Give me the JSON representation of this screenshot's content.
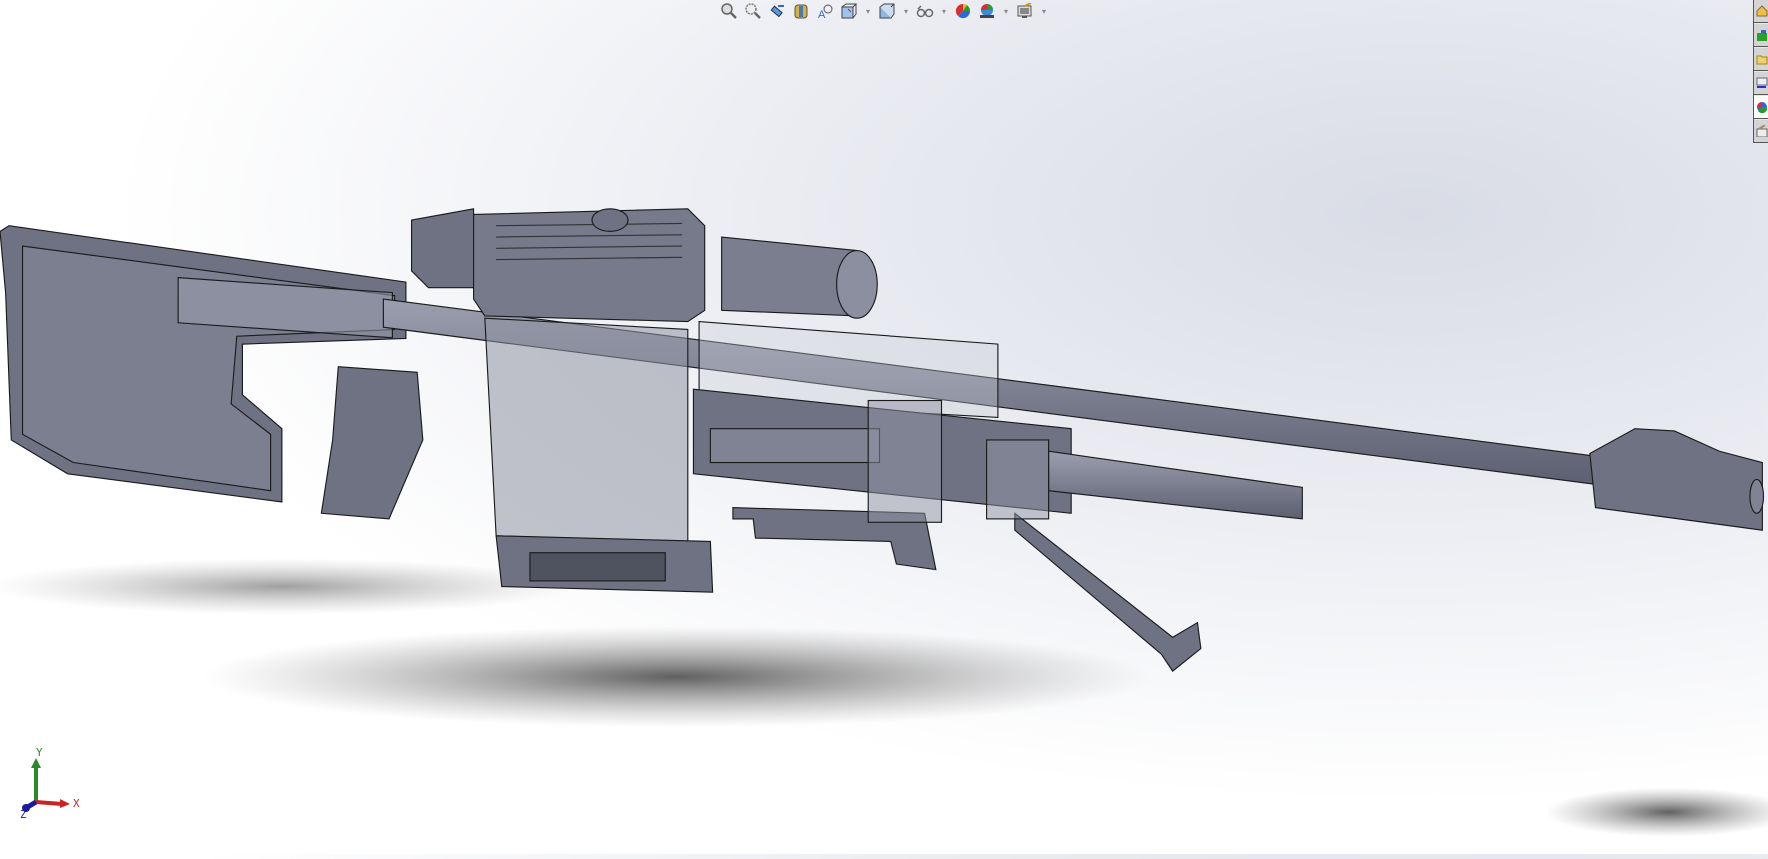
{
  "heads_up_toolbar": {
    "items": [
      {
        "icon": "zoom-to-fit-icon"
      },
      {
        "icon": "zoom-to-area-icon"
      },
      {
        "icon": "previous-view-icon"
      },
      {
        "icon": "section-view-icon"
      },
      {
        "icon": "dynamic-annotation-views-icon"
      },
      {
        "icon": "view-orientation-icon",
        "dropdown": true
      },
      {
        "icon": "display-style-icon",
        "dropdown": true
      },
      {
        "icon": "hide-show-items-icon",
        "dropdown": true
      },
      {
        "icon": "edit-appearance-icon"
      },
      {
        "icon": "apply-scene-icon",
        "dropdown": true
      },
      {
        "icon": "view-settings-icon",
        "dropdown": true
      }
    ]
  },
  "task_pane": {
    "tabs": [
      {
        "icon": "solidworks-resources-icon"
      },
      {
        "icon": "design-library-icon"
      },
      {
        "icon": "file-explorer-icon"
      },
      {
        "icon": "view-palette-icon"
      },
      {
        "icon": "appearances-scenes-icon",
        "active": true
      },
      {
        "icon": "custom-properties-icon"
      }
    ]
  },
  "triad": {
    "x_label": "X",
    "y_label": "Y",
    "z_label": "Z"
  },
  "colors": {
    "model": "#6e7283",
    "model_light": "#8b8fa0",
    "edge": "#1a1a1a",
    "x_axis": "#cc2222",
    "y_axis": "#2a8a2a",
    "z_axis": "#1a1aa0"
  }
}
